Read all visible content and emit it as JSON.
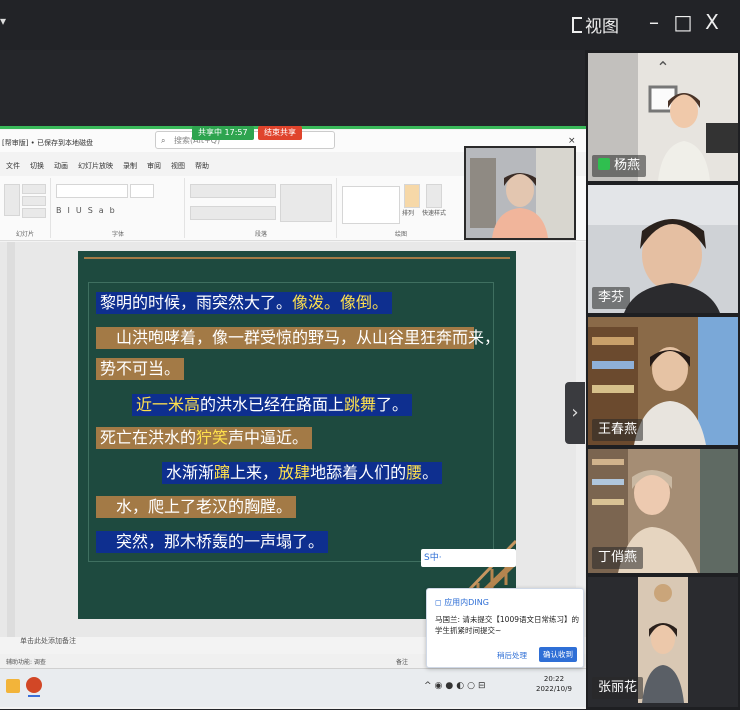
{
  "window": {
    "view_label": "视图",
    "minimize": "–",
    "maximize": "□",
    "close": "X"
  },
  "share": {
    "badge": "共享中 17:57",
    "stop": "结束共享"
  },
  "ppt": {
    "title": "[帮审版] • 已保存到本地磁盘",
    "search_placeholder": "搜索(Alt+Q)",
    "menu": [
      "文件",
      "切换",
      "动画",
      "幻灯片放映",
      "录制",
      "审阅",
      "视图",
      "帮助"
    ],
    "ribbon_groups": [
      "幻灯片",
      "字体",
      "段落",
      "绘图"
    ],
    "ribbon_extra": [
      "排列",
      "快速样式"
    ],
    "bottom_note": "单击此处添加备注",
    "status_left": "辅助功能: 调查",
    "status_right": "备注",
    "clock_time": "20:22",
    "clock_date": "2022/10/9"
  },
  "slide": {
    "lines": [
      {
        "parts": [
          "黎明的时候，雨突然大了。",
          "像泼。像倒。"
        ],
        "hl": [
          false,
          true
        ],
        "color": "bl"
      },
      {
        "parts": [
          "　山洪咆哮着，像一群受惊的野马，从山谷里狂奔而来，"
        ],
        "hl": [
          false
        ],
        "color": "br"
      },
      {
        "parts": [
          "势不可当。"
        ],
        "hl": [
          false
        ],
        "color": "br"
      },
      {
        "parts": [
          "近一米高",
          "的洪水已经在路面上",
          "跳舞",
          "了。"
        ],
        "hl": [
          true,
          false,
          true,
          false
        ],
        "color": "bl"
      },
      {
        "parts": [
          "死亡在洪水的",
          "狞笑",
          "声中逼近。"
        ],
        "hl": [
          false,
          true,
          false
        ],
        "color": "br"
      },
      {
        "parts": [
          "水渐渐",
          "蹿",
          "上来，",
          "放肆",
          "地舔着人们的",
          "腰",
          "。"
        ],
        "hl": [
          false,
          true,
          false,
          true,
          false,
          true,
          false
        ],
        "color": "bl"
      },
      {
        "parts": [
          "　水，爬上了老汉的胸膛。"
        ],
        "hl": [
          false
        ],
        "color": "br"
      },
      {
        "parts": [
          "　突然，那木桥轰的一声塌了。"
        ],
        "hl": [
          false
        ],
        "color": "bl"
      }
    ]
  },
  "notification": {
    "app": "应用内DING",
    "message": "马国兰: 请未提交【1009语文日常练习】的学生抓紧时间提交~",
    "later": "稍后处理",
    "confirm": "确认收到"
  },
  "sogou": "S中·",
  "participants": [
    {
      "name": "杨燕",
      "mic": true
    },
    {
      "name": "李芬",
      "mic": false
    },
    {
      "name": "王春燕",
      "mic": false
    },
    {
      "name": "丁俏燕",
      "mic": false
    },
    {
      "name": "张丽花",
      "mic": false
    }
  ],
  "colors": {
    "share_green": "#2ea44f",
    "stop_red": "#e0442c",
    "slide_bg": "#1e4a3f",
    "stripe_blue": "#0e2f8f",
    "stripe_brown": "#a37a46",
    "highlight": "#ffe14d"
  }
}
